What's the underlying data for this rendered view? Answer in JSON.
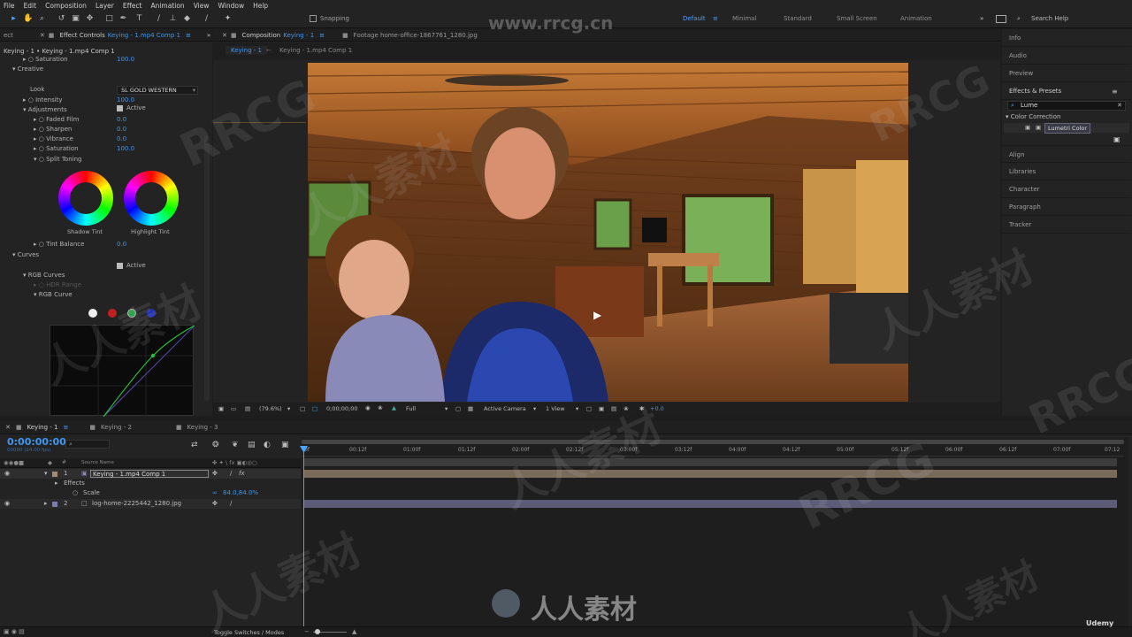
{
  "menu": [
    "File",
    "Edit",
    "Composition",
    "Layer",
    "Effect",
    "Animation",
    "View",
    "Window",
    "Help"
  ],
  "toolbar": {
    "snapping_label": "Snapping",
    "workspaces": [
      "Default",
      "Minimal",
      "Standard",
      "Small Screen",
      "Animation"
    ],
    "search_placeholder": "Search Help"
  },
  "effect_controls": {
    "tab_prefix": "Effect Controls",
    "tab_target": "Keying - 1.mp4 Comp 1",
    "header_path": "Keying - 1 • Keying - 1.mp4 Comp 1",
    "saturation_top_label": "Saturation",
    "saturation_top_value": "100.0",
    "creative_label": "Creative",
    "active_label": "Active",
    "look_label": "Look",
    "look_value": "SL GOLD WESTERN",
    "intensity_label": "Intensity",
    "intensity_value": "100.0",
    "adjustments_label": "Adjustments",
    "faded_film_label": "Faded Film",
    "faded_film_value": "0.0",
    "sharpen_label": "Sharpen",
    "sharpen_value": "0.0",
    "vibrance_label": "Vibrance",
    "vibrance_value": "0.0",
    "saturation_label": "Saturation",
    "saturation_value": "100.0",
    "split_toning_label": "Split Toning",
    "shadow_tint_label": "Shadow Tint",
    "highlight_tint_label": "Highlight Tint",
    "tint_balance_label": "Tint Balance",
    "tint_balance_value": "0.0",
    "curves_label": "Curves",
    "curves_active_label": "Active",
    "rgb_curves_label": "RGB Curves",
    "hdr_range_label": "HDR Range",
    "rgb_curve_label": "RGB Curve"
  },
  "composition": {
    "tab_label": "Composition",
    "tab_target": "Keying - 1",
    "footage_tab": "Footage home-office-1867761_1280.jpg",
    "breadcrumb_1": "Keying - 1",
    "breadcrumb_2": "Keying - 1.mp4 Comp 1",
    "zoom": "(79.6%)",
    "timecode": "0;00;00;00",
    "resolution": "Full",
    "camera": "Active Camera",
    "view": "1 View",
    "exposure": "+0.0"
  },
  "right_panel": {
    "info": "Info",
    "audio": "Audio",
    "preview": "Preview",
    "effects_presets": "Effects & Presets",
    "search_value": "Lume",
    "category": "Color Correction",
    "result": "Lumetri Color",
    "align": "Align",
    "libraries": "Libraries",
    "character": "Character",
    "paragraph": "Paragraph",
    "tracker": "Tracker"
  },
  "timeline": {
    "tabs": [
      "Keying - 1",
      "Keying - 2",
      "Keying - 3"
    ],
    "timecode": "0:00:00:00",
    "fps": "00000 (24.00 fps)",
    "source_name_header": "Source Name",
    "layer1_num": "1",
    "layer1_name": "Keying - 1.mp4 Comp 1",
    "effects_label": "Effects",
    "scale_label": "Scale",
    "scale_value": "84.0,84.0%",
    "layer2_num": "2",
    "layer2_name": "log-home-2225442_1280.jpg",
    "ruler": [
      "0f",
      "00:12f",
      "01:00f",
      "01:12f",
      "02:00f",
      "02:12f",
      "03:00f",
      "03:12f",
      "04:00f",
      "04:12f",
      "05:00f",
      "05:12f",
      "06:00f",
      "06:12f",
      "07:00f",
      "07:12"
    ],
    "toggle_label": "Toggle Switches / Modes"
  },
  "watermark": {
    "site": "www.rrcg.cn",
    "brand": "RRCG",
    "cn": "人人素材",
    "udemy": "Udemy"
  },
  "colors": {
    "accent": "#3f96ef",
    "layer1_bar": "#7a6a5a",
    "layer2_bar": "#5c5c78",
    "playhead": "#4aa3ff"
  }
}
